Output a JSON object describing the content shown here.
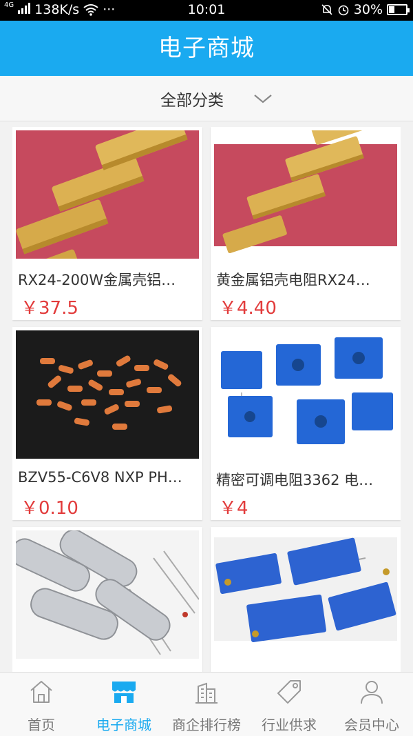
{
  "status": {
    "signal": "4G",
    "speed": "138K/s",
    "dots": "···",
    "time": "10:01",
    "battery": "30%",
    "battery_level": 0.3
  },
  "header": {
    "title": "电子商城"
  },
  "filter": {
    "label": "全部分类"
  },
  "products": [
    {
      "name": "RX24-200W金属壳铝…",
      "price": "￥37.5",
      "image": "gold-resistors"
    },
    {
      "name": "黄金属铝壳电阻RX24…",
      "price": "￥4.40",
      "image": "gold-resistors"
    },
    {
      "name": "BZV55-C6V8 NXP PH…",
      "price": "￥0.10",
      "image": "glass-diodes"
    },
    {
      "name": "精密可调电阻3362 电…",
      "price": "￥4",
      "image": "blue-trimpots"
    },
    {
      "name": "",
      "price": "",
      "image": "crystal-oscillators"
    },
    {
      "name": "",
      "price": "",
      "image": "blue-trimpots-long"
    }
  ],
  "tabs": [
    {
      "label": "首页",
      "icon": "home-icon",
      "active": false
    },
    {
      "label": "电子商城",
      "icon": "shop-icon",
      "active": true
    },
    {
      "label": "商企排行榜",
      "icon": "building-icon",
      "active": false
    },
    {
      "label": "行业供求",
      "icon": "tag-icon",
      "active": false
    },
    {
      "label": "会员中心",
      "icon": "person-icon",
      "active": false
    }
  ],
  "colors": {
    "accent": "#1aaaf0",
    "price": "#e23b3b"
  }
}
